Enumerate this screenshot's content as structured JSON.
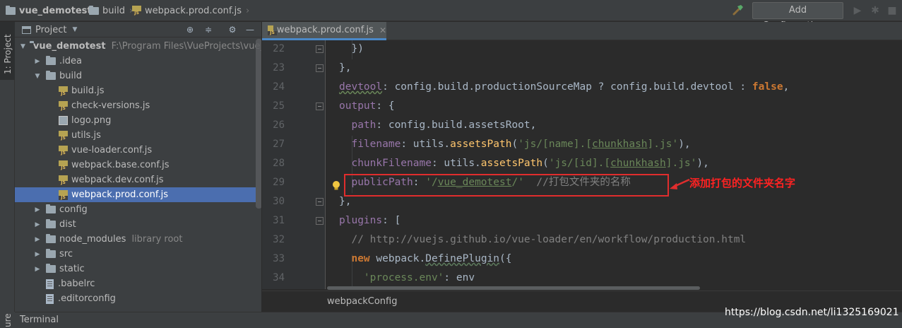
{
  "navbar": {
    "crumbs": [
      "vue_demotest",
      "build",
      "webpack.prod.conf.js"
    ],
    "add_configuration_label": "Add Configuration..."
  },
  "left_strip": {
    "project_tab_label": "1: Project",
    "bottom_tab_label": "ure"
  },
  "project_panel": {
    "title": "Project",
    "tree": [
      {
        "label": "vue_demotest",
        "extra": "F:\\Program Files\\VueProjects\\vue_dem",
        "kind": "folder",
        "level": 0,
        "expanded": true
      },
      {
        "label": ".idea",
        "kind": "folder",
        "level": 1,
        "expanded": false
      },
      {
        "label": "build",
        "kind": "folder",
        "level": 1,
        "expanded": true
      },
      {
        "label": "build.js",
        "kind": "js",
        "level": 2
      },
      {
        "label": "check-versions.js",
        "kind": "js",
        "level": 2
      },
      {
        "label": "logo.png",
        "kind": "image",
        "level": 2
      },
      {
        "label": "utils.js",
        "kind": "js",
        "level": 2
      },
      {
        "label": "vue-loader.conf.js",
        "kind": "js",
        "level": 2
      },
      {
        "label": "webpack.base.conf.js",
        "kind": "js",
        "level": 2
      },
      {
        "label": "webpack.dev.conf.js",
        "kind": "js",
        "level": 2
      },
      {
        "label": "webpack.prod.conf.js",
        "kind": "js",
        "level": 2,
        "selected": true
      },
      {
        "label": "config",
        "kind": "folder",
        "level": 1,
        "expanded": false
      },
      {
        "label": "dist",
        "kind": "folder",
        "level": 1,
        "expanded": false
      },
      {
        "label": "node_modules",
        "extra": "library root",
        "kind": "folder",
        "level": 1,
        "expanded": false
      },
      {
        "label": "src",
        "kind": "folder",
        "level": 1,
        "expanded": false
      },
      {
        "label": "static",
        "kind": "folder",
        "level": 1,
        "expanded": false
      },
      {
        "label": ".babelrc",
        "kind": "file",
        "level": 1
      },
      {
        "label": ".editorconfig",
        "kind": "file",
        "level": 1
      }
    ]
  },
  "editor": {
    "tab_label": "webpack.prod.conf.js",
    "line_numbers": [
      "22",
      "23",
      "24",
      "25",
      "26",
      "27",
      "28",
      "29",
      "30",
      "31",
      "32",
      "33",
      "34"
    ],
    "breadcrumb": "webpackConfig",
    "annotation": "添加打包的文件夹名字",
    "lines": [
      [
        {
          "t": "  })"
        }
      ],
      [
        {
          "t": "},"
        }
      ],
      [
        {
          "t": "devtool",
          "c": "prop w"
        },
        {
          "t": ": config.build.productionSourceMap ? config.build.devtool : "
        },
        {
          "t": "false",
          "c": "kw"
        },
        {
          "t": ","
        }
      ],
      [
        {
          "t": "output",
          "c": "prop"
        },
        {
          "t": ": {"
        }
      ],
      [
        {
          "t": "  path",
          "c": "prop"
        },
        {
          "t": ": config.build.assetsRoot,"
        }
      ],
      [
        {
          "t": "  filename",
          "c": "prop"
        },
        {
          "t": ": utils."
        },
        {
          "t": "assetsPath",
          "c": "fn"
        },
        {
          "t": "("
        },
        {
          "t": "'js/[name].[",
          "c": "str"
        },
        {
          "t": "chunkhash",
          "c": "str u"
        },
        {
          "t": "].js'",
          "c": "str"
        },
        {
          "t": "),"
        }
      ],
      [
        {
          "t": "  chunkFilename",
          "c": "prop"
        },
        {
          "t": ": utils."
        },
        {
          "t": "assetsPath",
          "c": "fn"
        },
        {
          "t": "("
        },
        {
          "t": "'js/[id].[",
          "c": "str"
        },
        {
          "t": "chunkhash",
          "c": "str u"
        },
        {
          "t": "].js'",
          "c": "str"
        },
        {
          "t": "),"
        }
      ],
      [
        {
          "t": "  publicPath",
          "c": "prop"
        },
        {
          "t": ": "
        },
        {
          "t": "'/",
          "c": "str"
        },
        {
          "t": "vue_demotest",
          "c": "str u2"
        },
        {
          "t": "/'",
          "c": "str"
        },
        {
          "t": "  //打包文件夹的名称",
          "c": "cmt"
        }
      ],
      [
        {
          "t": "},"
        }
      ],
      [
        {
          "t": "plugins",
          "c": "prop"
        },
        {
          "t": ": ["
        }
      ],
      [
        {
          "t": "  // http://vuejs.github.io/vue-loader/en/workflow/production.html",
          "c": "cmt"
        }
      ],
      [
        {
          "t": "  "
        },
        {
          "t": "new",
          "c": "kw"
        },
        {
          "t": " webpack."
        },
        {
          "t": "DefinePlugin",
          "c": "wb"
        },
        {
          "t": "({"
        }
      ],
      [
        {
          "t": "    "
        },
        {
          "t": "'process.env'",
          "c": "str"
        },
        {
          "t": ": env"
        }
      ]
    ]
  },
  "bottom_bar": {
    "terminal_label": "Terminal"
  },
  "watermark": "https://blog.csdn.net/li1325169021",
  "colors": {
    "background": "#2b2b2b",
    "panel": "#3c3f41",
    "selection": "#4b6eaf",
    "keyword": "#cc7832",
    "property": "#9876aa",
    "string": "#6a8759",
    "function": "#ffc66d",
    "comment": "#808080",
    "annotation_red": "#e02d2d"
  }
}
